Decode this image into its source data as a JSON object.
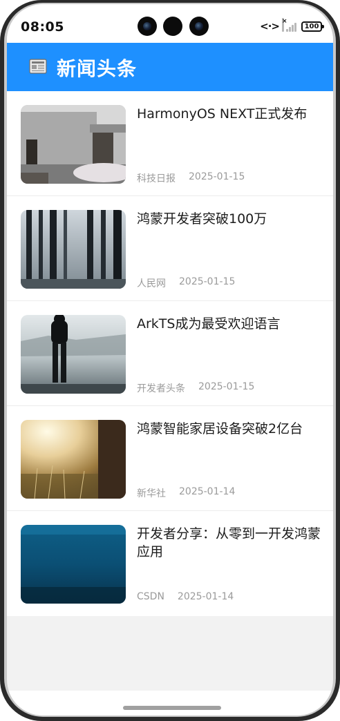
{
  "status_bar": {
    "time": "08:05",
    "network_icon": "<·>",
    "battery": "100"
  },
  "header": {
    "icon": "newspaper-icon",
    "title": "新闻头条"
  },
  "news": [
    {
      "title": "HarmonyOS NEXT正式发布",
      "source": "科技日报",
      "date": "2025-01-15",
      "image": "old-building-photo"
    },
    {
      "title": "鸿蒙开发者突破100万",
      "source": "人民网",
      "date": "2025-01-15",
      "image": "forest-photo"
    },
    {
      "title": "ArkTS成为最受欢迎语言",
      "source": "开发者头条",
      "date": "2025-01-15",
      "image": "lake-person-photo"
    },
    {
      "title": "鸿蒙智能家居设备突破2亿台",
      "source": "新华社",
      "date": "2025-01-14",
      "image": "sunlit-field-photo"
    },
    {
      "title": "开发者分享：从零到一开发鸿蒙应用",
      "source": "CSDN",
      "date": "2025-01-14",
      "image": "underwater-photo"
    }
  ],
  "colors": {
    "header_bg": "#1e90ff",
    "title_text": "#1c1c1c",
    "meta_text": "#9a9a9a"
  }
}
